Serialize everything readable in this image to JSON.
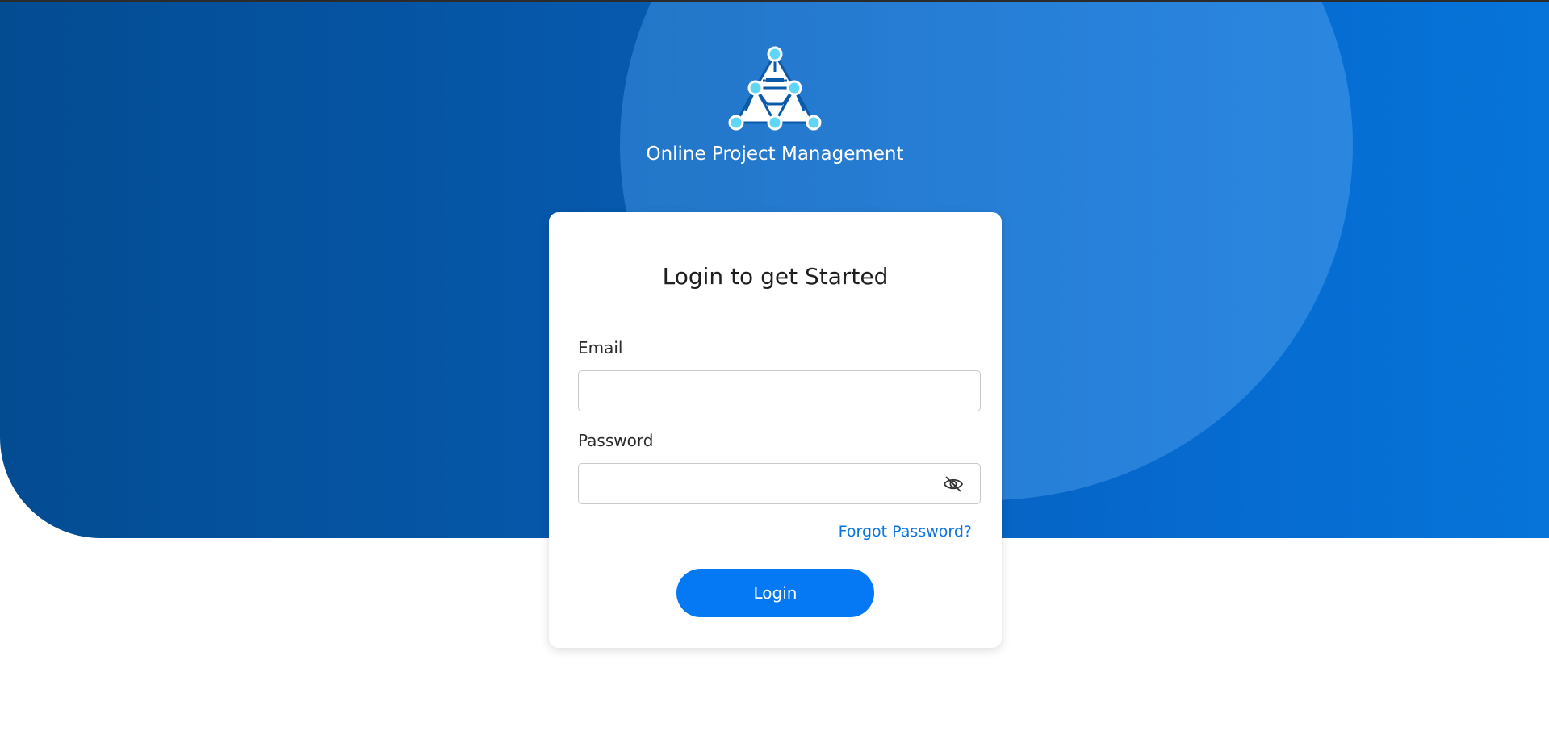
{
  "app": {
    "title": "Online Project Management",
    "logo_icon": "network-triangle-logo-icon"
  },
  "login_card": {
    "heading": "Login to get Started",
    "email": {
      "label": "Email",
      "value": "",
      "placeholder": ""
    },
    "password": {
      "label": "Password",
      "value": "",
      "placeholder": "",
      "toggle_icon": "eye-slash-icon"
    },
    "forgot_password_link": "Forgot Password?",
    "login_button": "Login"
  },
  "colors": {
    "hero_dark": "#044c92",
    "hero_light": "#0674d9",
    "primary_button": "#0579f4",
    "link": "#0a73e6",
    "logo_node": "#5fd6f5"
  }
}
